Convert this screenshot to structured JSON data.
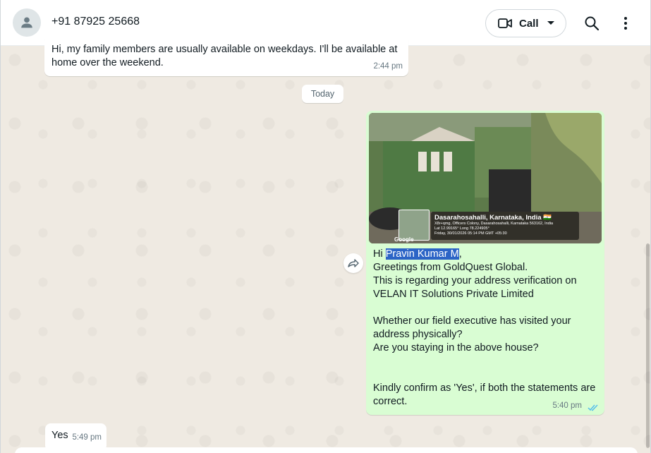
{
  "header": {
    "contact_name": "+91 87925 25668",
    "call_label": "Call",
    "avatar_icon": "person-icon",
    "video_icon": "video-camera-icon",
    "caret_icon": "caret-down-icon",
    "search_icon": "search-icon",
    "menu_icon": "more-vertical-icon"
  },
  "messages": {
    "m1": {
      "text": "Hi, my family members are usually available on weekdays. I'll be available at home over the weekend.",
      "time": "2:44 pm"
    },
    "day_separator": "Today",
    "m2": {
      "photo": {
        "location_title": "Dasarahosahalli, Karnataka, India 🇮🇳",
        "address": "X8r+qmg, Officers Colony, Dasarahosahalli, Karnataka 563162, India",
        "coords": "Lat 12.99165° Long 78.224905°",
        "timestamp": "Friday, 30/01/2026 05:14 PM GMT +05:30",
        "map_label": "Google"
      },
      "greeting_prefix": "Hi ",
      "selected_name": "Pravin Kumar M",
      "greeting_suffix": ",",
      "body": "Greetings from GoldQuest Global.\nThis is regarding your address verification on VELAN IT Solutions Private Limited\n\nWhether our field executive has visited your address physically?\nAre you staying in the above house?\n\n\nKindly confirm as 'Yes', if both the statements are correct.",
      "time": "5:40 pm",
      "status_icon": "double-check-icon",
      "status_color": "#53bdeb"
    },
    "m3": {
      "text": "Yes",
      "time": "5:49 pm"
    }
  },
  "colors": {
    "outgoing_bubble": "#d9fdd3",
    "incoming_bubble": "#ffffff",
    "chat_background": "#efeae2",
    "selection": "#2c64c6"
  }
}
